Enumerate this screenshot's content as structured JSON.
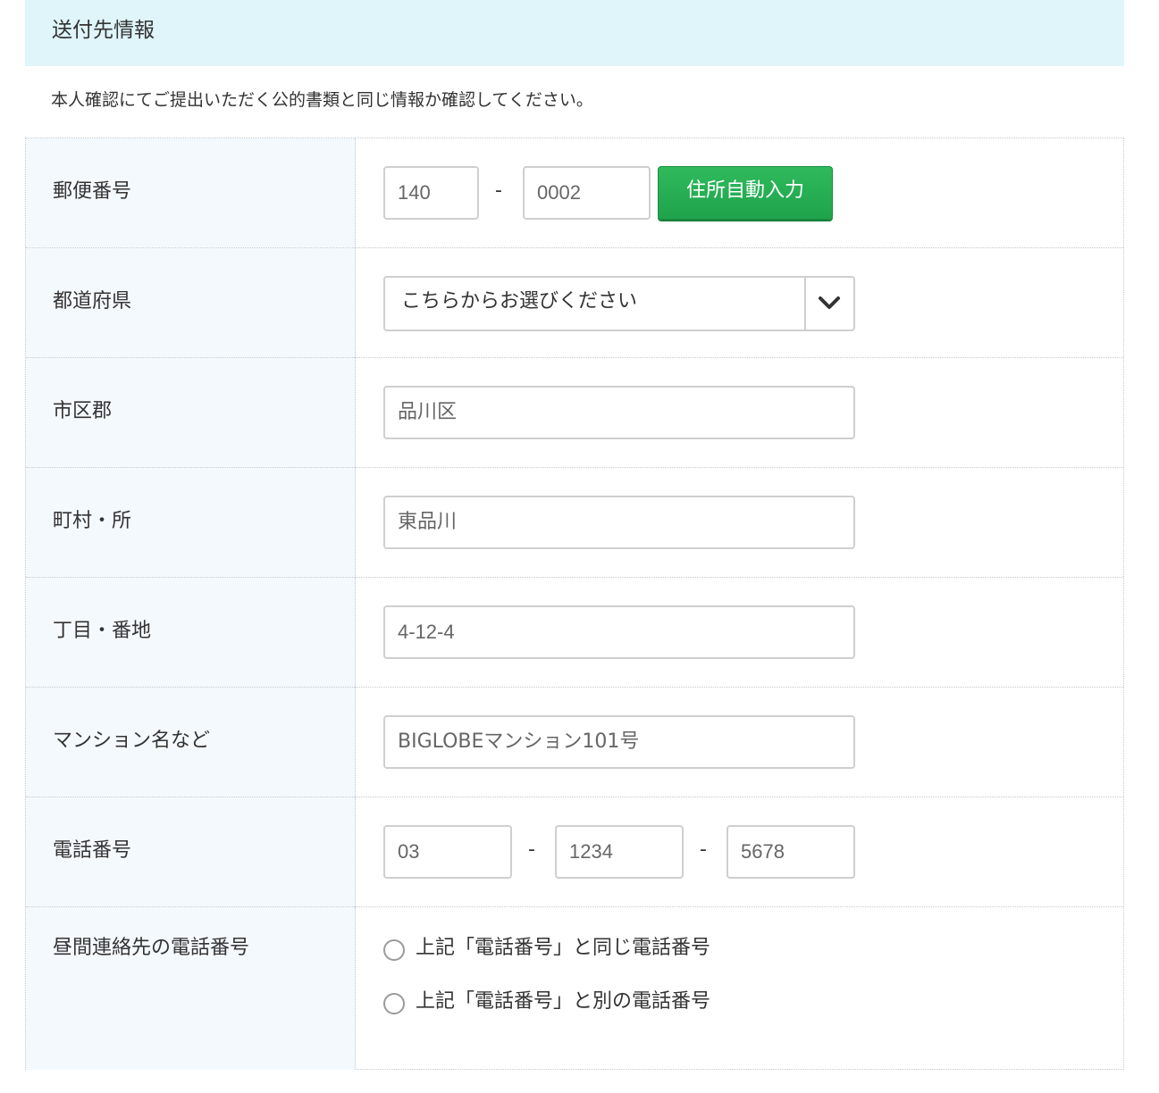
{
  "header": {
    "title": "送付先情報"
  },
  "notice": "本人確認にてご提出いただく公的書類と同じ情報か確認してください。",
  "rows": {
    "postal": {
      "label": "郵便番号",
      "part1": "140",
      "separator": "-",
      "part2": "0002",
      "button": "住所自動入力"
    },
    "prefecture": {
      "label": "都道府県",
      "selected": "こちらからお選びください"
    },
    "city": {
      "label": "市区郡",
      "value": "品川区"
    },
    "town": {
      "label": "町村・所",
      "value": "東品川"
    },
    "block": {
      "label": "丁目・番地",
      "value": "4-12-4"
    },
    "building": {
      "label": "マンション名など",
      "value": "BIGLOBEマンション101号"
    },
    "phone": {
      "label": "電話番号",
      "part1": "03",
      "separator": "-",
      "part2": "1234",
      "part3": "5678"
    },
    "daytime_phone": {
      "label": "昼間連絡先の電話番号",
      "options": [
        "上記「電話番号」と同じ電話番号",
        "上記「電話番号」と別の電話番号"
      ]
    }
  },
  "colors": {
    "header_bg": "#dff5fa",
    "label_bg": "#f4f9fe",
    "button_green": "#22a94f",
    "border": "#cfcfcf"
  },
  "icons": {
    "select_arrow": "chevron-down-icon"
  }
}
